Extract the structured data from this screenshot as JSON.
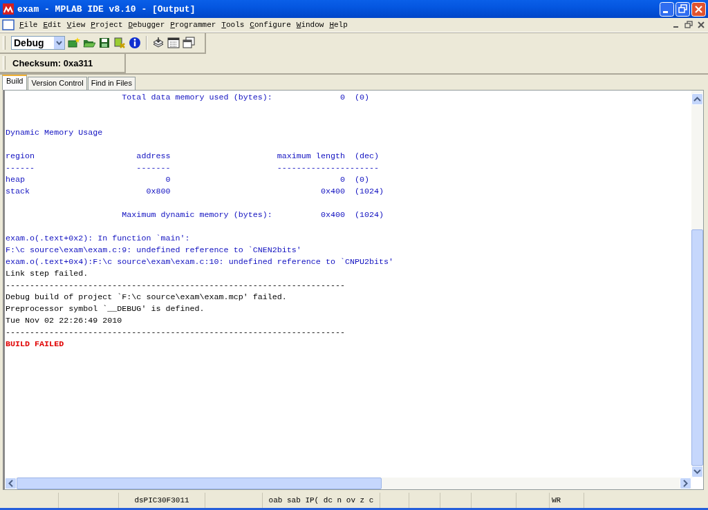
{
  "window": {
    "title": "exam - MPLAB IDE v8.10 - [Output]"
  },
  "menu": [
    "File",
    "Edit",
    "View",
    "Project",
    "Debugger",
    "Programmer",
    "Tools",
    "Configure",
    "Window",
    "Help"
  ],
  "toolbar": {
    "configuration": "Debug"
  },
  "checksum": "Checksum: 0xa311",
  "tabs": [
    {
      "label": "Build",
      "selected": true
    },
    {
      "label": "Version Control",
      "selected": false
    },
    {
      "label": "Find in Files",
      "selected": false
    }
  ],
  "output": [
    {
      "kind": "info",
      "text": "                        Total data memory used (bytes):              0  (0)"
    },
    {
      "kind": "blank"
    },
    {
      "kind": "blank"
    },
    {
      "kind": "info",
      "text": "Dynamic Memory Usage"
    },
    {
      "kind": "blank"
    },
    {
      "kind": "info",
      "text": "region                     address                      maximum length  (dec)"
    },
    {
      "kind": "info",
      "text": "------                     -------                      ---------------------"
    },
    {
      "kind": "info",
      "text": "heap                             0                                   0  (0)"
    },
    {
      "kind": "info",
      "text": "stack                        0x800                               0x400  (1024)"
    },
    {
      "kind": "blank"
    },
    {
      "kind": "info",
      "text": "                        Maximum dynamic memory (bytes):          0x400  (1024)"
    },
    {
      "kind": "blank"
    },
    {
      "kind": "info",
      "text": "exam.o(.text+0x2): In function `main':"
    },
    {
      "kind": "info",
      "text": "F:\\c source\\exam\\exam.c:9: undefined reference to `CNEN2bits'"
    },
    {
      "kind": "info",
      "text": "exam.o(.text+0x4):F:\\c source\\exam\\exam.c:10: undefined reference to `CNPU2bits'"
    },
    {
      "kind": "plain",
      "text": "Link step failed."
    },
    {
      "kind": "plain",
      "text": "----------------------------------------------------------------------"
    },
    {
      "kind": "plain",
      "text": "Debug build of project `F:\\c source\\exam\\exam.mcp' failed."
    },
    {
      "kind": "plain",
      "text": "Preprocessor symbol `__DEBUG' is defined."
    },
    {
      "kind": "plain",
      "text": "Tue Nov 02 22:26:49 2010"
    },
    {
      "kind": "plain",
      "text": "----------------------------------------------------------------------"
    },
    {
      "kind": "error",
      "text": "BUILD FAILED"
    }
  ],
  "status_bar": {
    "device": "dsPIC30F3011",
    "flags": "oab sab IP( dc n ov z c",
    "mode": "WR"
  }
}
